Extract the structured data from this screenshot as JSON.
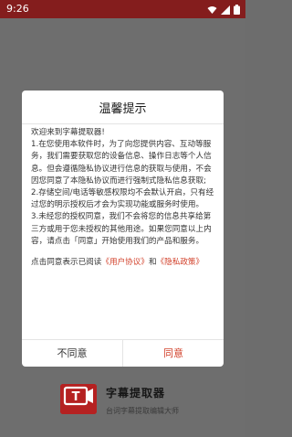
{
  "status_bar": {
    "time": "9:26",
    "icons": [
      "wifi-icon",
      "signal-icon",
      "battery-icon"
    ]
  },
  "splash": {
    "logo_icon": "subtitle-extractor-logo",
    "logo_text": "字幕提取器",
    "app_name": "字幕提取器",
    "tagline": "台词字幕提取编辑大师"
  },
  "dialog": {
    "title": "温馨提示",
    "paragraphs": {
      "welcome": "欢迎来到字幕提取器!",
      "p1": "1.在您使用本软件时，为了向您提供内容、互动等服务，我们需要获取您的设备信息、操作日志等个人信息。但会遵循隐私协议进行信息的获取与使用，不会因您同意了本隐私协议而进行强制式隐私信息获取;",
      "p2": "2.存储空间/电话等敏感权限均不会默认开启，只有经过您的明示授权后才会为实现功能或服务时使用。",
      "p3": "3.未经您的授权同意，我们不会将您的信息共享给第三方或用于您未授权的其他用途。如果您同意以上内容，请点击「同意」开始使用我们的产品和服务。"
    },
    "notice_prefix": "点击同意表示已阅读",
    "user_agreement": "《用户协议》",
    "and": "和",
    "privacy_policy": "《隐私政策》",
    "disagree_label": "不同意",
    "agree_label": "同意"
  },
  "colors": {
    "status_bar": "#841d1d",
    "accent": "#d2402a",
    "overlay_bg": "#6e6e6e"
  }
}
